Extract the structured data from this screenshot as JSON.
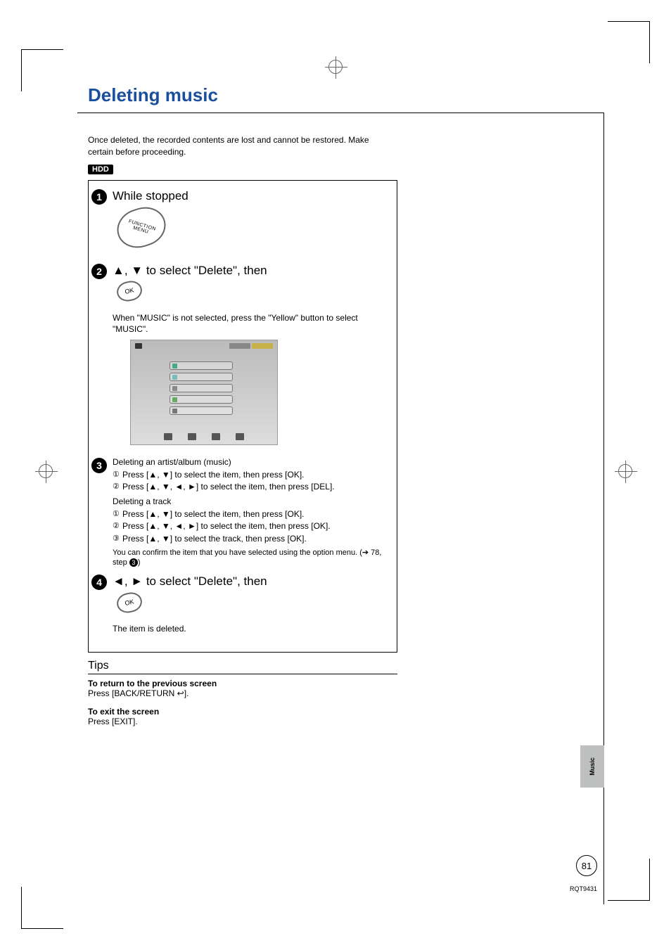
{
  "title": "Deleting music",
  "intro": "Once deleted, the recorded contents are lost and cannot be restored. Make certain before proceeding.",
  "hdd_badge": "HDD",
  "steps": {
    "s1": {
      "label": "While stopped",
      "remote_label": "FUNCTION MENU"
    },
    "s2": {
      "line_prefix": "▲, ▼ to select \"Delete\", then",
      "ok_label": "OK",
      "note": "When \"MUSIC\" is not selected, press the \"Yellow\" button to select \"MUSIC\"."
    },
    "s3": {
      "artist_hd": "Deleting an artist/album (music)",
      "artist_l1": "Press [▲, ▼] to select the item, then press [OK].",
      "artist_l2": "Press [▲, ▼, ◄, ►] to select the item, then press [DEL].",
      "track_hd": "Deleting a track",
      "track_l1": "Press [▲, ▼] to select the item, then press [OK].",
      "track_l2": "Press [▲, ▼, ◄, ►] to select the item, then press [OK].",
      "track_l3": "Press [▲, ▼] to select the track, then press [OK].",
      "confirm_pre": "You can confirm the item that you have selected using the option menu. (➔ 78, step ",
      "confirm_step": "3",
      "confirm_post": ")"
    },
    "s4": {
      "line": "◄, ► to select \"Delete\", then",
      "ok_label": "OK",
      "result": "The item is deleted."
    }
  },
  "tips": {
    "heading": "Tips",
    "t1_b": "To return to the previous screen",
    "t1_t": "Press [BACK/RETURN ↩].",
    "t2_b": "To exit the screen",
    "t2_t": "Press [EXIT]."
  },
  "side_tab": "Music",
  "page_number": "81",
  "doc_code": "RQT9431",
  "circnums": {
    "c1": "①",
    "c2": "②",
    "c3": "③"
  }
}
